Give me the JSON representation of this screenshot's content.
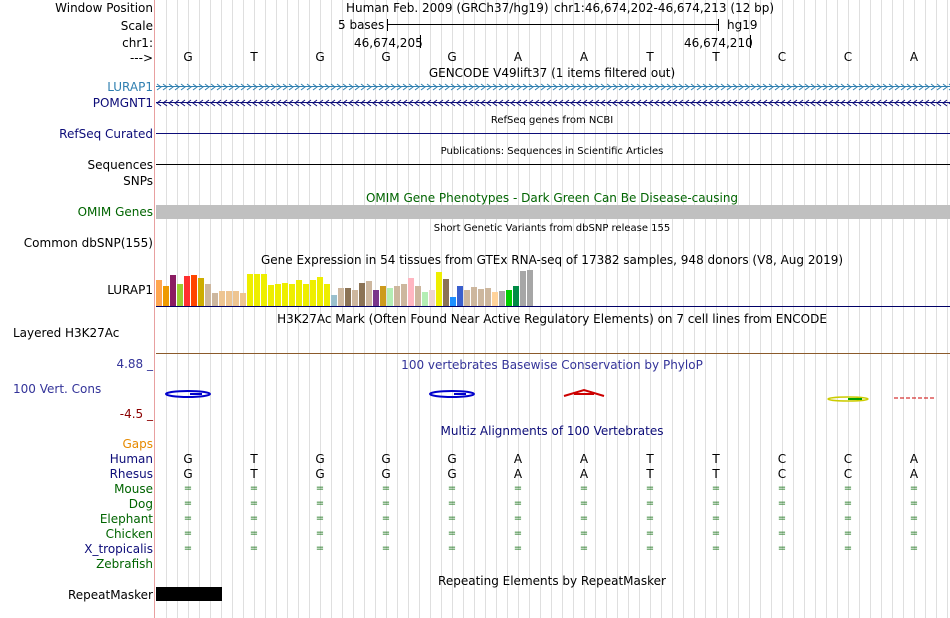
{
  "header": {
    "window_position_label": "Window Position",
    "scale_label": "Scale",
    "chrom_label": "chr1:",
    "strand_label": "--->",
    "assembly_text": "Human Feb. 2009 (GRCh37/hg19)",
    "position_text": "chr1:46,674,202-46,674,213 (12 bp)",
    "scale_text": "5 bases",
    "scale_assembly": "hg19",
    "coord_left": "46,674,205",
    "coord_right": "46,674,210"
  },
  "bases": [
    "G",
    "T",
    "G",
    "G",
    "G",
    "A",
    "A",
    "T",
    "T",
    "C",
    "C",
    "A"
  ],
  "tracks": {
    "gencode": {
      "title": "GENCODE V49lift37 (1 items filtered out)",
      "genes": [
        "LURAP1",
        "POMGNT1"
      ],
      "lurap1_color": "#2f7fb0",
      "pomgnt1_color": "#0c0c78"
    },
    "refseq": {
      "title": "RefSeq genes from NCBI",
      "label": "RefSeq Curated",
      "color": "#0c0c78"
    },
    "publications": {
      "title": "Publications: Sequences in Scientific Articles",
      "label": "Sequences"
    },
    "snps": {
      "label": "SNPs"
    },
    "omim": {
      "title": "OMIM Gene Phenotypes - Dark Green Can Be Disease-causing",
      "label": "OMIM Genes",
      "color": "#006400",
      "bar_color": "#c0c0c0"
    },
    "dbsnp": {
      "title": "Short Genetic Variants from dbSNP release 155",
      "label": "Common dbSNP(155)"
    },
    "gtex": {
      "title": "Gene Expression in 54 tissues from GTEx RNA-seq of 17382 samples, 948 donors (V8, Aug 2019)",
      "label": "LURAP1",
      "tissue_levels": [
        0.72,
        0.55,
        0.85,
        0.6,
        0.82,
        0.85,
        0.78,
        0.62,
        0.35,
        0.42,
        0.42,
        0.42,
        0.35,
        0.9,
        0.9,
        0.88,
        0.58,
        0.6,
        0.65,
        0.62,
        0.72,
        0.6,
        0.72,
        0.8,
        0.6,
        0.3,
        0.5,
        0.5,
        0.45,
        0.65,
        0.7,
        0.45,
        0.55,
        0.5,
        0.55,
        0.62,
        0.78,
        0.55,
        0.4,
        0.45,
        0.95,
        0.75,
        0.25,
        0.55,
        0.45,
        0.52,
        0.48,
        0.5,
        0.38,
        0.42,
        0.45,
        0.55,
        0.98,
        1.0
      ],
      "tissue_colors": [
        "#ffa54f",
        "#ee9a00",
        "#8b1c62",
        "#9acd32",
        "#ff3030",
        "#ff4500",
        "#cdad00",
        "#cdb79e",
        "#cdb79e",
        "#eec591",
        "#eec591",
        "#eec591",
        "#eec591",
        "#eeee00",
        "#eeee00",
        "#eeee00",
        "#eeee00",
        "#eeee00",
        "#eeee00",
        "#eeee00",
        "#eeee00",
        "#eeee00",
        "#eeee00",
        "#eeee00",
        "#eeee00",
        "#9ac0cd",
        "#cdb79e",
        "#8b7355",
        "#cdb79e",
        "#8b7355",
        "#cdb79e",
        "#7a378b",
        "#cd9b1d",
        "#b4eeb4",
        "#cdb79e",
        "#cdb79e",
        "#ffb6c1",
        "#cdb79e",
        "#b4eeb4",
        "#eed5d2",
        "#eeee00",
        "#8b7355",
        "#1e90ff",
        "#3a5fcd",
        "#cdb79e",
        "#cdb79e",
        "#cdb79e",
        "#cdb79e",
        "#ffd39b",
        "#a6a6a6",
        "#00cd00",
        "#008b45",
        "#a6a6a6",
        "#a6a6a6"
      ]
    },
    "h3k27ac": {
      "title": "H3K27Ac Mark (Often Found Near Active Regulatory Elements) on 7 cell lines from ENCODE",
      "label": "Layered H3K27Ac"
    },
    "phylop": {
      "title": "100 vertebrates Basewise Conservation by PhyloP",
      "label": "100 Vert. Cons",
      "max_label": "4.88 _",
      "min_label": "-4.5 _",
      "color": "#333399"
    },
    "multiz": {
      "title": "Multiz Alignments of 100 Vertebrates",
      "gaps_label": "Gaps",
      "species": [
        "Human",
        "Rhesus",
        "Mouse",
        "Dog",
        "Elephant",
        "Chicken",
        "X_tropicalis",
        "Zebrafish"
      ],
      "species_colors": [
        "#0c0c78",
        "#0c0c78",
        "#006400",
        "#006400",
        "#006400",
        "#006400",
        "#0c0c78",
        "#006400"
      ],
      "human_seq": [
        "G",
        "T",
        "G",
        "G",
        "G",
        "A",
        "A",
        "T",
        "T",
        "C",
        "C",
        "A"
      ],
      "rhesus_seq": [
        "G",
        "T",
        "G",
        "G",
        "G",
        "A",
        "A",
        "T",
        "T",
        "C",
        "C",
        "A"
      ],
      "match_symbol": "="
    },
    "repeatmasker": {
      "title": "Repeating Elements by RepeatMasker",
      "label": "RepeatMasker"
    }
  }
}
